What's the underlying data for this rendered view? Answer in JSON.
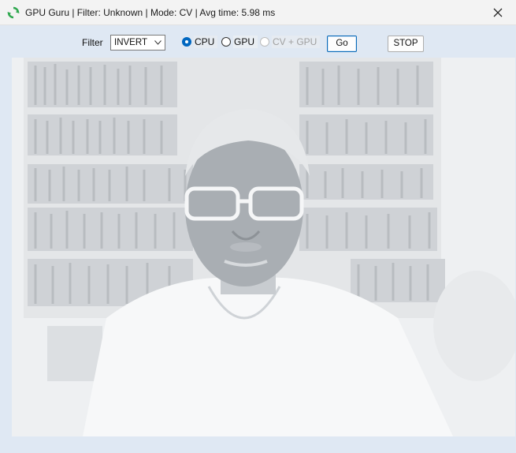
{
  "window": {
    "title": "GPU Guru | Filter: Unknown | Mode: CV | Avg time: 5.98 ms",
    "close_icon": "close-icon",
    "app_icon": "refresh-icon",
    "accent": "#0067c0"
  },
  "toolbar": {
    "filter_label": "Filter",
    "filter_value": "INVERT",
    "mode_options": [
      {
        "label": "CPU",
        "selected": true,
        "enabled": true
      },
      {
        "label": "GPU",
        "selected": false,
        "enabled": true
      },
      {
        "label": "CV + GPU",
        "selected": false,
        "enabled": false
      }
    ],
    "go_label": "Go",
    "stop_label": "STOP"
  },
  "video": {
    "description_icon": "video-frame"
  }
}
